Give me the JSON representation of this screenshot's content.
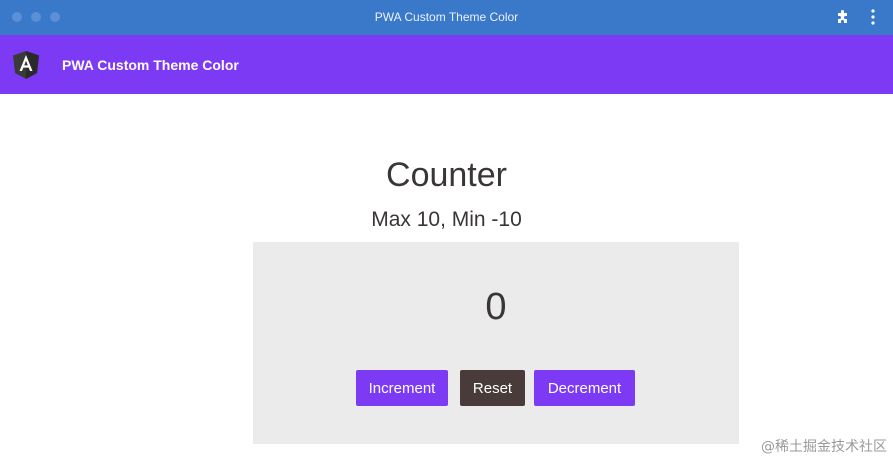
{
  "window": {
    "title": "PWA Custom Theme Color",
    "titlebar_color": "#3a78c9"
  },
  "toolbar": {
    "title": "PWA Custom Theme Color",
    "color": "#7c3af5",
    "logo_icon": "angular-logo-icon"
  },
  "counter": {
    "heading": "Counter",
    "limits": "Max 10, Min -10",
    "value": "0",
    "panel_color": "#ebebeb",
    "buttons": {
      "increment": "Increment",
      "reset": "Reset",
      "decrement": "Decrement"
    }
  },
  "watermark": "@稀土掘金技术社区"
}
